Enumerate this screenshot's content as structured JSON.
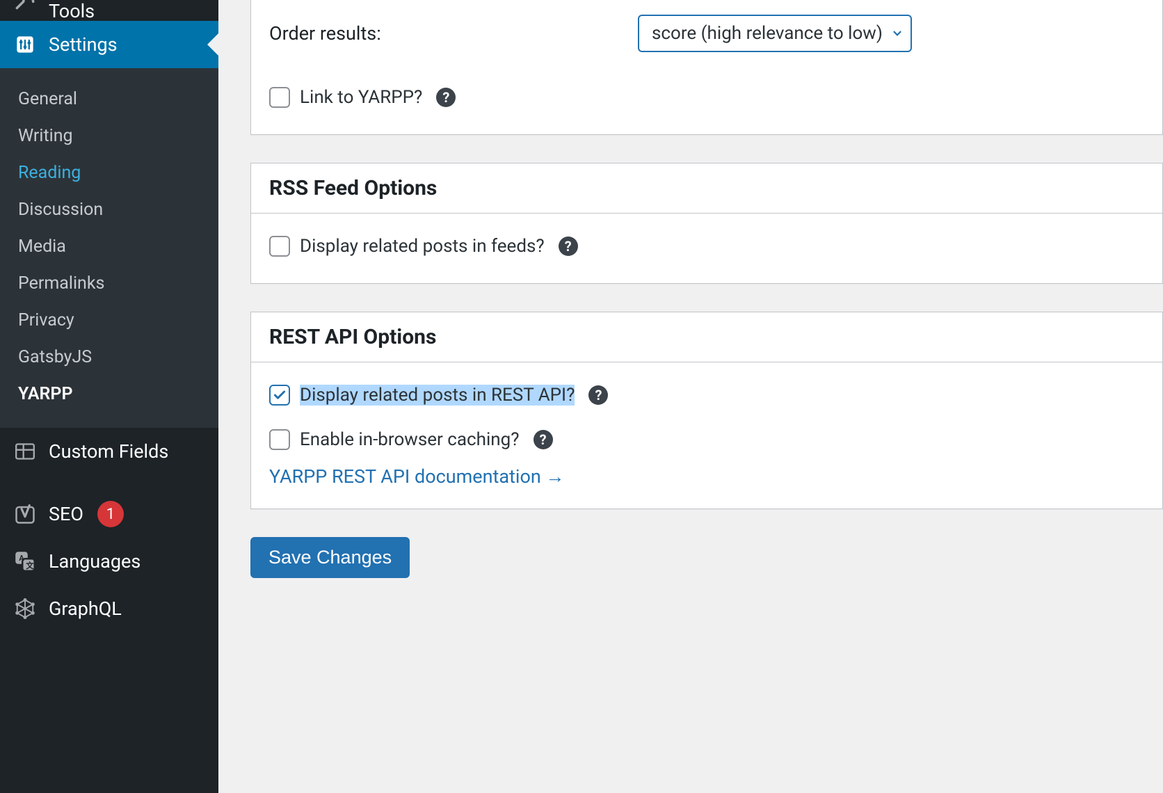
{
  "sidebar": {
    "tools_label": "Tools",
    "settings_label": "Settings",
    "sub": {
      "general": "General",
      "writing": "Writing",
      "reading": "Reading",
      "discussion": "Discussion",
      "media": "Media",
      "permalinks": "Permalinks",
      "privacy": "Privacy",
      "gatsbyjs": "GatsbyJS",
      "yarpp": "YARPP"
    },
    "custom_fields": "Custom Fields",
    "seo": "SEO",
    "seo_badge": "1",
    "languages": "Languages",
    "graphql": "GraphQL"
  },
  "panels": {
    "top": {
      "order_results_label": "Order results:",
      "order_results_value": "score (high relevance to low)",
      "link_to_yarpp": "Link to YARPP?"
    },
    "rss": {
      "title": "RSS Feed Options",
      "display_in_feeds": "Display related posts in feeds?"
    },
    "rest": {
      "title": "REST API Options",
      "display_in_rest": "Display related posts in REST API?",
      "enable_caching": "Enable in-browser caching?",
      "doc_link": "YARPP REST API documentation →"
    }
  },
  "save_label": "Save Changes"
}
